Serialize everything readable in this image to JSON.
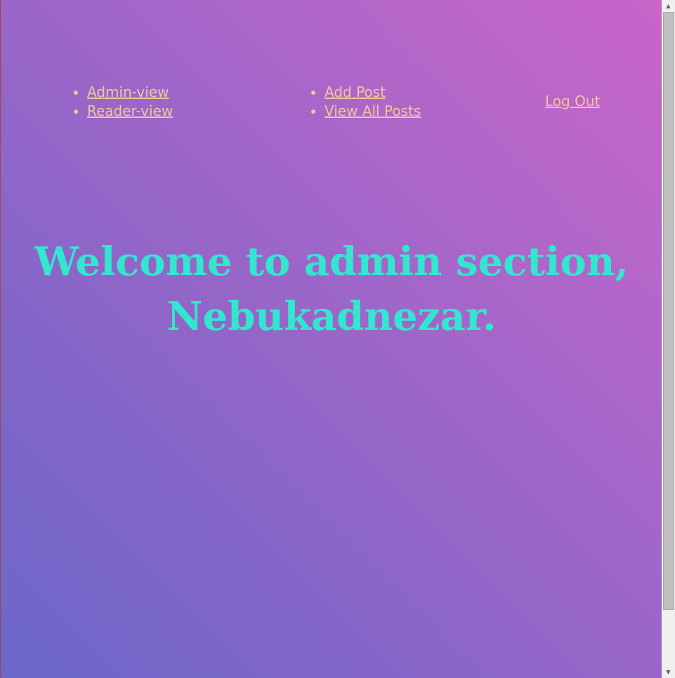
{
  "nav": {
    "views": [
      "Admin-view",
      "Reader-view"
    ],
    "posts": [
      "Add Post",
      "View All Posts"
    ],
    "logout_label": "Log Out"
  },
  "welcome": {
    "line1": "Welcome to admin section,",
    "line2": "Nebukadnezar."
  },
  "scrollbar": {
    "up_icon": "arrow-up-icon",
    "down_icon": "arrow-down-icon"
  },
  "colors": {
    "link": "#f1c6a0",
    "heading": "#33e6cf",
    "gradient_start": "#6a67c9",
    "gradient_end": "#c965c9"
  }
}
